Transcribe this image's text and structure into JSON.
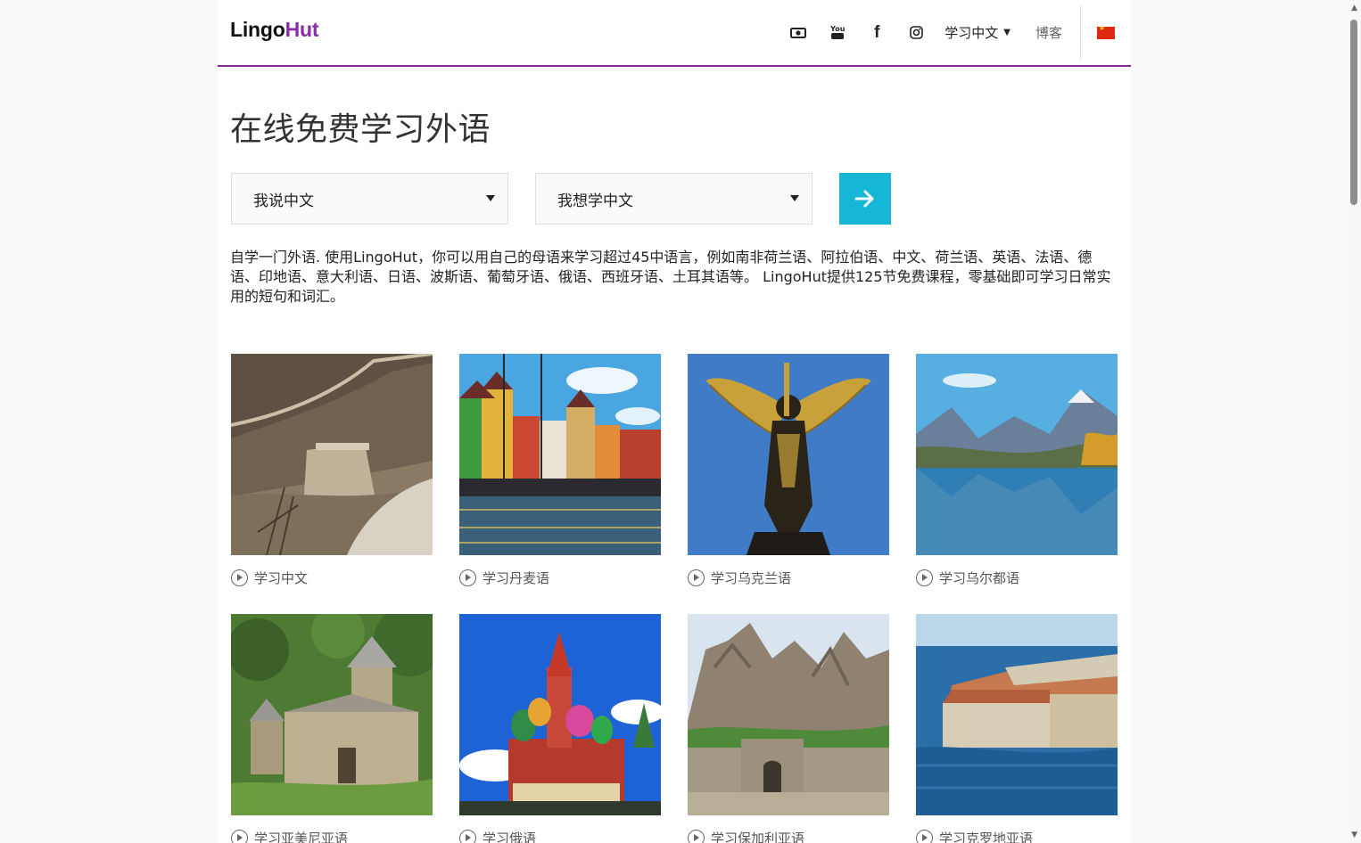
{
  "header": {
    "logo_part1": "Lingo",
    "logo_part2": "Hut",
    "icons": [
      "camera-icon",
      "youtube-icon",
      "facebook-icon",
      "instagram-icon"
    ],
    "youtube_text": "You",
    "facebook_text": "f",
    "language_menu": "学习中文",
    "blog": "博客",
    "flag": "china-flag-icon"
  },
  "main": {
    "title": "在线免费学习外语",
    "select_speak": "我说中文",
    "select_learn": "我想学中文",
    "description": "自学一门外语. 使用LingoHut，你可以用自己的母语来学习超过45中语言，例如南非荷兰语、阿拉伯语、中文、荷兰语、英语、法语、德语、印地语、意大利语、日语、波斯语、葡萄牙语、俄语、西班牙语、土耳其语等。 LingoHut提供125节免费课程，零基础即可学习日常实用的短句和词汇。"
  },
  "cards": [
    {
      "label": "学习中文",
      "image": "great-wall"
    },
    {
      "label": "学习丹麦语",
      "image": "copenhagen-harbor"
    },
    {
      "label": "学习乌克兰语",
      "image": "archangel-statue"
    },
    {
      "label": "学习乌尔都语",
      "image": "mountain-lake"
    },
    {
      "label": "学习亚美尼亚语",
      "image": "armenian-monastery"
    },
    {
      "label": "学习俄语",
      "image": "st-basils-cathedral"
    },
    {
      "label": "学习保加利亚语",
      "image": "rock-fortress"
    },
    {
      "label": "学习克罗地亚语",
      "image": "dubrovnik-coast"
    }
  ],
  "colors": {
    "accent": "#7b2d8e",
    "logo_hut": "#8a2ca8",
    "button": "#16b6d6"
  }
}
